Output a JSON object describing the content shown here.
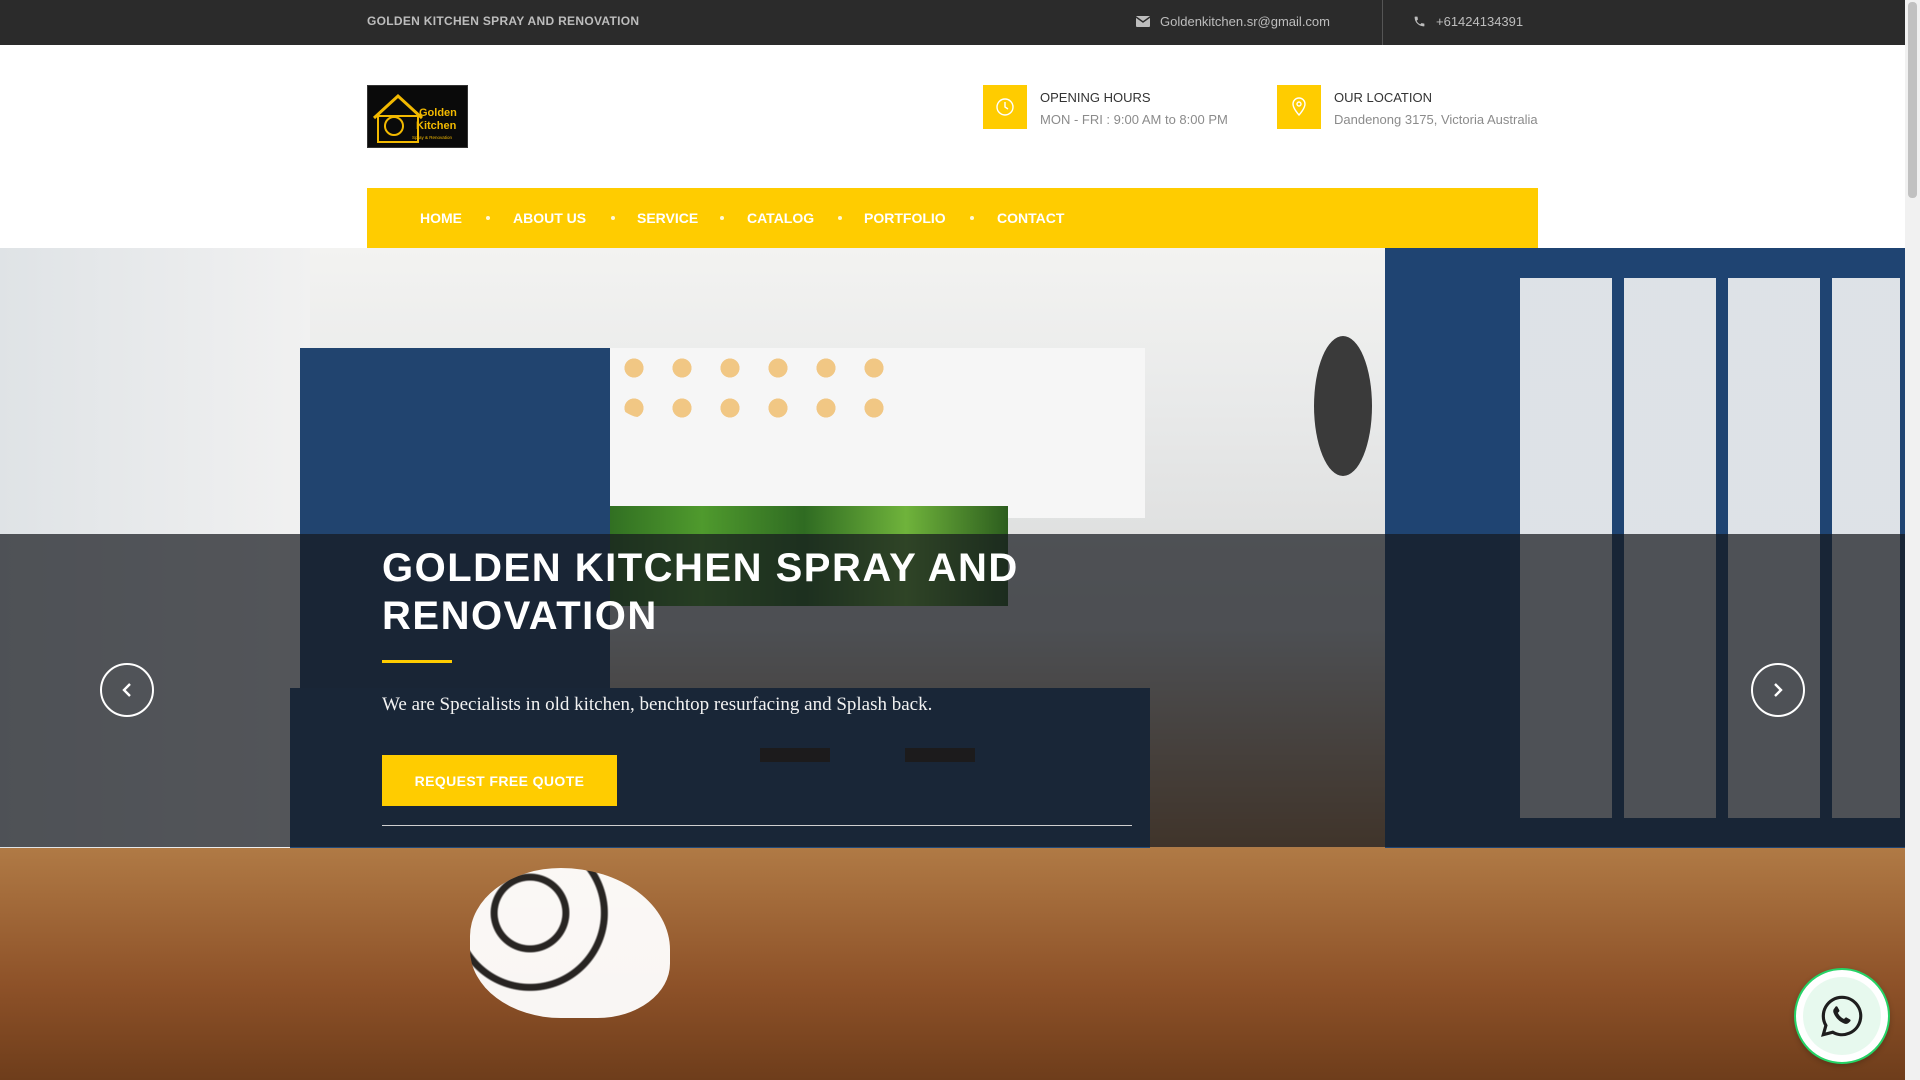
{
  "topbar": {
    "brand": "GOLDEN KITCHEN SPRAY AND RENOVATION",
    "email": "Goldenkitchen.sr@gmail.com",
    "phone": "+61424134391",
    "email_icon": "envelope-icon",
    "phone_icon": "phone-icon"
  },
  "logo": {
    "line1": "Golden",
    "line2": "Kitchen",
    "tagline": "Spray & Renovation"
  },
  "info": {
    "hours_title": "OPENING HOURS",
    "hours_value": "MON - FRI : 9:00 AM to 8:00 PM",
    "location_title": "OUR LOCATION",
    "location_value": "Dandenong 3175, Victoria Australia",
    "hours_icon": "clock-icon",
    "location_icon": "map-pin-icon"
  },
  "nav": {
    "items": [
      "HOME",
      "ABOUT US",
      "SERVICE",
      "CATALOG",
      "PORTFOLIO",
      "CONTACT"
    ]
  },
  "hero": {
    "title": "GOLDEN KITCHEN SPRAY AND RENOVATION",
    "subtitle": "We are Specialists in old kitchen, benchtop resurfacing and Splash back.",
    "cta": "REQUEST FREE QUOTE",
    "prev_icon": "chevron-left-icon",
    "next_icon": "chevron-right-icon"
  },
  "whatsapp": {
    "icon": "whatsapp-icon"
  },
  "colors": {
    "accent": "#ffcc00",
    "topbar": "#2b2b2b",
    "whatsapp": "#25d366"
  }
}
